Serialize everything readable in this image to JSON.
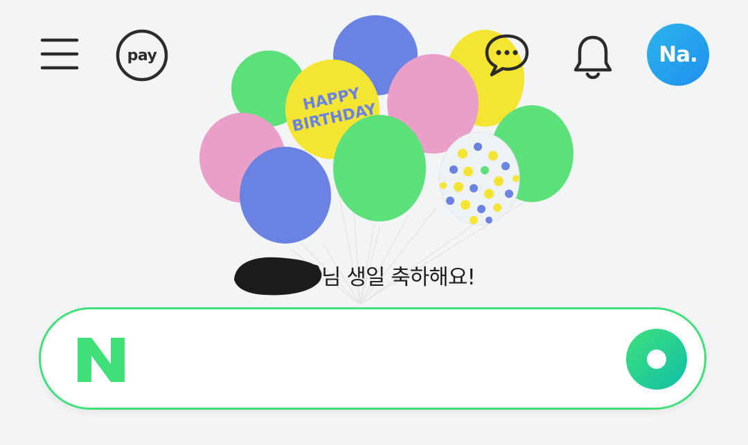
{
  "header": {
    "menu_icon": "hamburger-menu-icon",
    "pay_label": "pay",
    "talk_icon": "chat-bubble-icon",
    "bell_icon": "bell-icon",
    "avatar_label": "Na."
  },
  "birthday": {
    "balloon_text_line1": "HAPPY",
    "balloon_text_line2": "BIRTHDAY",
    "greeting_text": "님 생일 축하해요!"
  },
  "search": {
    "placeholder": "",
    "value": "",
    "logo_letter": "N",
    "logo_icon": "naver-n-logo-icon",
    "green_button_icon": "green-ring-button-icon"
  },
  "colors": {
    "background": "#f3f4f6",
    "brand_green": "#03c75a",
    "search_border": "#3fe07a",
    "avatar_blue": "#1f8ff0",
    "balloon_green": "#5be07a",
    "balloon_blue": "#6a83e3",
    "balloon_pink": "#ea9fc8",
    "balloon_yellow": "#f4e532"
  }
}
